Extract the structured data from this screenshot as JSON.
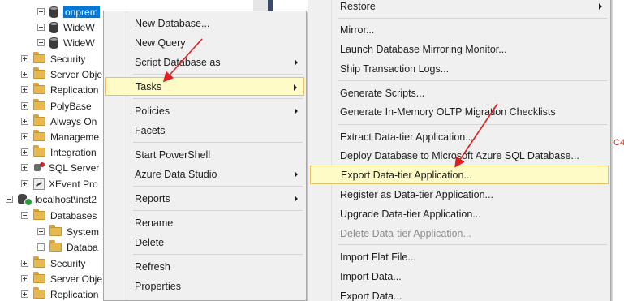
{
  "tree": {
    "items": [
      {
        "label": "onprem",
        "selected": true
      },
      {
        "label": "WideW"
      },
      {
        "label": "WideW"
      },
      {
        "label": "Security"
      },
      {
        "label": "Server Obje"
      },
      {
        "label": "Replication"
      },
      {
        "label": "PolyBase"
      },
      {
        "label": "Always On"
      },
      {
        "label": "Manageme"
      },
      {
        "label": "Integration"
      },
      {
        "label": "SQL Server"
      },
      {
        "label": "XEvent Pro"
      },
      {
        "label": "localhost\\inst2"
      },
      {
        "label": "Databases"
      },
      {
        "label": "System"
      },
      {
        "label": "Databa"
      },
      {
        "label": "Security"
      },
      {
        "label": "Server Obje"
      },
      {
        "label": "Replication"
      }
    ]
  },
  "context_menu": {
    "items": [
      {
        "label": "New Database..."
      },
      {
        "label": "New Query"
      },
      {
        "label": "Script Database as"
      },
      {
        "label": "Tasks"
      },
      {
        "label": "Policies"
      },
      {
        "label": "Facets"
      },
      {
        "label": "Start PowerShell"
      },
      {
        "label": "Azure Data Studio"
      },
      {
        "label": "Reports"
      },
      {
        "label": "Rename"
      },
      {
        "label": "Delete"
      },
      {
        "label": "Refresh"
      },
      {
        "label": "Properties"
      }
    ]
  },
  "tasks_menu": {
    "items": [
      {
        "label": "Restore"
      },
      {
        "label": "Mirror..."
      },
      {
        "label": "Launch Database Mirroring Monitor..."
      },
      {
        "label": "Ship Transaction Logs..."
      },
      {
        "label": "Generate Scripts..."
      },
      {
        "label": "Generate In-Memory OLTP Migration Checklists"
      },
      {
        "label": "Extract Data-tier Application..."
      },
      {
        "label": "Deploy Database to Microsoft Azure SQL Database..."
      },
      {
        "label": "Export Data-tier Application..."
      },
      {
        "label": "Register as Data-tier Application..."
      },
      {
        "label": "Upgrade Data-tier Application..."
      },
      {
        "label": "Delete Data-tier Application..."
      },
      {
        "label": "Import Flat File..."
      },
      {
        "label": "Import Data..."
      },
      {
        "label": "Export Data..."
      }
    ]
  },
  "edge_text": "C4",
  "colors": {
    "highlight_fill": "#fefbc7",
    "highlight_border": "#e5c365",
    "selection": "#0078d7",
    "annotation_arrow": "#e02020"
  }
}
